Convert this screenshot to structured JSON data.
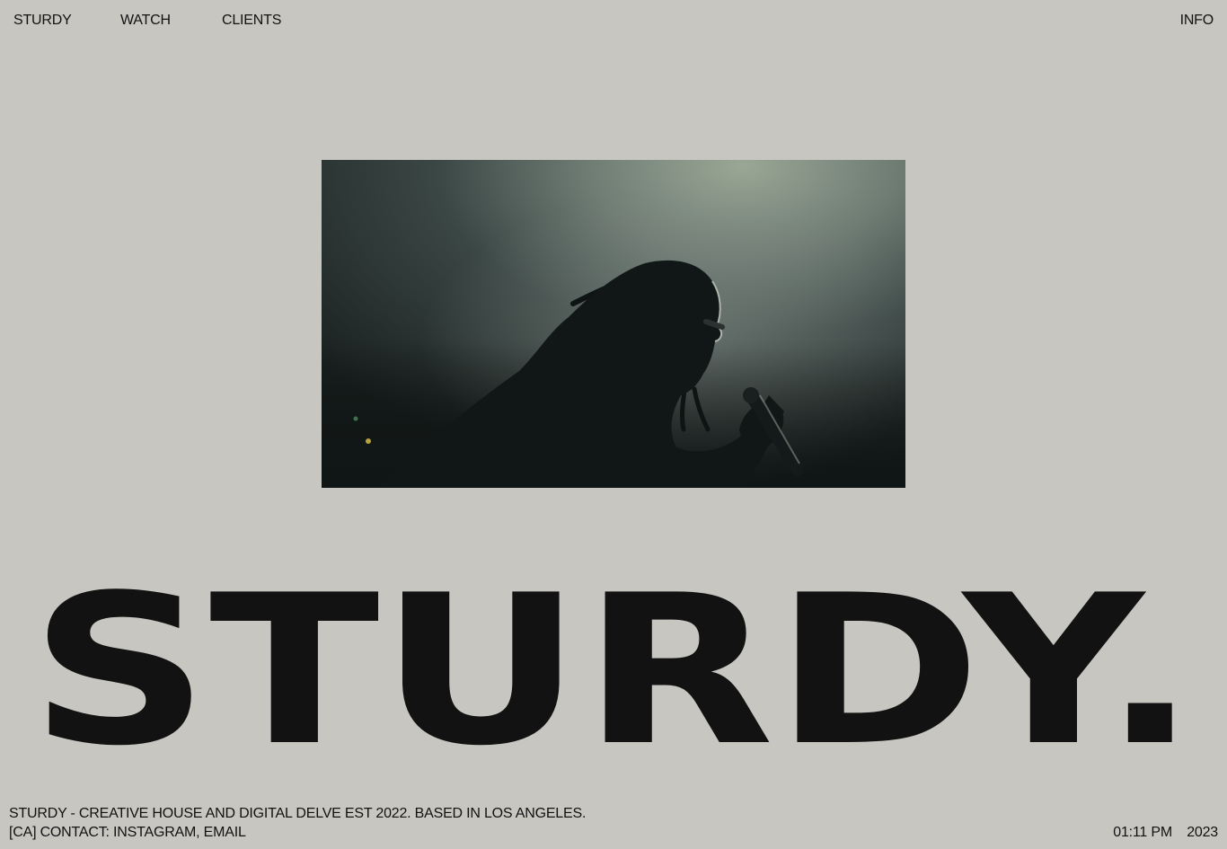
{
  "nav": {
    "brand": "STURDY",
    "watch": "WATCH",
    "clients": "CLIENTS",
    "info": "INFO"
  },
  "hero": {
    "image": "concert-performer-silhouette"
  },
  "wordmark": {
    "text": "STURDY."
  },
  "footer": {
    "tagline": "STURDY - CREATIVE HOUSE AND DIGITAL DELVE EST 2022. BASED IN LOS ANGELES.",
    "contact_prefix": "[CA] CONTACT:",
    "instagram": "INSTAGRAM",
    "separator": ",",
    "email": "EMAIL",
    "time": "01:11 PM",
    "year": "2023"
  },
  "colors": {
    "background": "#c7c6c1",
    "text": "#121212"
  }
}
